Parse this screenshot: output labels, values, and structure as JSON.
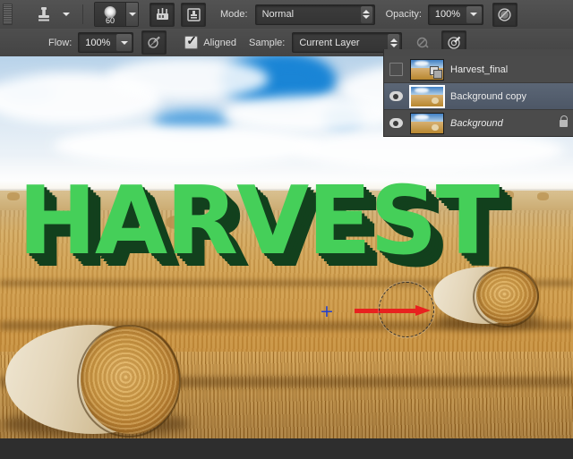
{
  "app": {
    "name": "Photoshop",
    "tool": "clone-stamp-tool"
  },
  "options_bar_row1": {
    "tool_icon": "clone-stamp-icon",
    "tool_preset_arrow": "chevron-down-icon",
    "brush_picker": {
      "icon": "brush-tip-icon",
      "size": "60",
      "arrow": "chevron-down-icon"
    },
    "toggle_brush_panel": "brush-panel-icon",
    "toggle_clone_source_panel": "clone-source-icon",
    "mode_label": "Mode:",
    "mode_value": "Normal",
    "opacity_label": "Opacity:",
    "opacity_value": "100%",
    "opacity_arrow": "chevron-down-icon",
    "pressure_opacity_icon": "tablet-pressure-opacity-icon"
  },
  "options_bar_row2": {
    "flow_label": "Flow:",
    "flow_value": "100%",
    "flow_arrow": "chevron-down-icon",
    "airbrush_icon": "airbrush-icon",
    "aligned_checked": true,
    "aligned_label": "Aligned",
    "sample_label": "Sample:",
    "sample_value": "Current Layer",
    "ignore_adjustment_icon": "ignore-adjustment-layers-icon",
    "pressure_size_icon": "tablet-pressure-size-icon"
  },
  "canvas": {
    "artwork_text": "HARVEST",
    "text_face_color": "#45cf59",
    "text_extrude_color": "#12401d",
    "annotation_arrow_color": "#e8221f",
    "clone_source_marker": "+",
    "clone_source_color": "#1f3fd0",
    "brush_cursor_diameter": 60
  },
  "layers_panel": {
    "layers": [
      {
        "name": "Harvest_final",
        "visible": false,
        "selected": false,
        "locked": false,
        "italic": false,
        "badge": "smart-object-badge"
      },
      {
        "name": "Background copy",
        "visible": true,
        "selected": true,
        "locked": false,
        "italic": false,
        "badge": ""
      },
      {
        "name": "Background",
        "visible": true,
        "selected": false,
        "locked": true,
        "italic": true,
        "badge": ""
      }
    ]
  }
}
